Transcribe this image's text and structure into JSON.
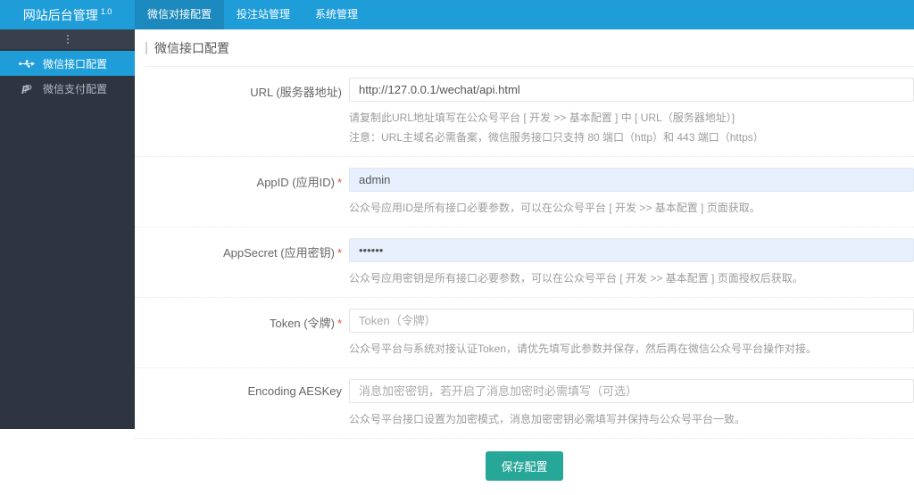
{
  "header": {
    "brand": "网站后台管理",
    "brand_version": "1.0",
    "tabs": [
      {
        "label": "微信对接配置",
        "active": true
      },
      {
        "label": "投注站管理",
        "active": false
      },
      {
        "label": "系统管理",
        "active": false
      }
    ]
  },
  "sidebar": {
    "items": [
      {
        "label": "微信接口配置",
        "icon": "usb-icon",
        "active": true
      },
      {
        "label": "微信支付配置",
        "icon": "paypal-icon",
        "active": false
      }
    ]
  },
  "main": {
    "title": "微信接口配置",
    "form": {
      "required_marker": "*",
      "fields": [
        {
          "label": "URL (服务器地址)",
          "required": false,
          "value": "http://127.0.0.1/wechat/api.html",
          "help": [
            "请复制此URL地址填写在公众号平台 [ 开发 >> 基本配置 ] 中 [ URL（服务器地址）]",
            "注意：URL主域名必需备案，微信服务接口只支持 80 端口（http）和 443 端口（https）"
          ]
        },
        {
          "label": "AppID (应用ID)",
          "required": true,
          "value": "admin",
          "help": [
            "公众号应用ID是所有接口必要参数，可以在公众号平台 [ 开发 >> 基本配置 ] 页面获取。"
          ]
        },
        {
          "label": "AppSecret (应用密钥)",
          "required": true,
          "value": "••••••",
          "help": [
            "公众号应用密钥是所有接口必要参数，可以在公众号平台 [ 开发 >> 基本配置 ] 页面授权后获取。"
          ]
        },
        {
          "label": "Token (令牌)",
          "required": true,
          "placeholder": "Token（令牌）",
          "help": [
            "公众号平台与系统对接认证Token，请优先填写此参数并保存，然后再在微信公众号平台操作对接。"
          ]
        },
        {
          "label": "Encoding AESKey",
          "required": false,
          "placeholder": "消息加密密钥，若开启了消息加密时必需填写（可选）",
          "help": [
            "公众号平台接口设置为加密模式，消息加密密钥必需填写并保持与公众号平台一致。"
          ]
        }
      ],
      "submit_label": "保存配置"
    }
  },
  "colors": {
    "header_blue": "#1e9dd8",
    "active_tab_blue": "#1b89bd",
    "sidebar_bg": "#2e3540",
    "active_item_blue": "#1e9dd8",
    "autofill_bg": "#e8f0fe",
    "button_teal": "#27a798",
    "required_red": "#e64545"
  }
}
